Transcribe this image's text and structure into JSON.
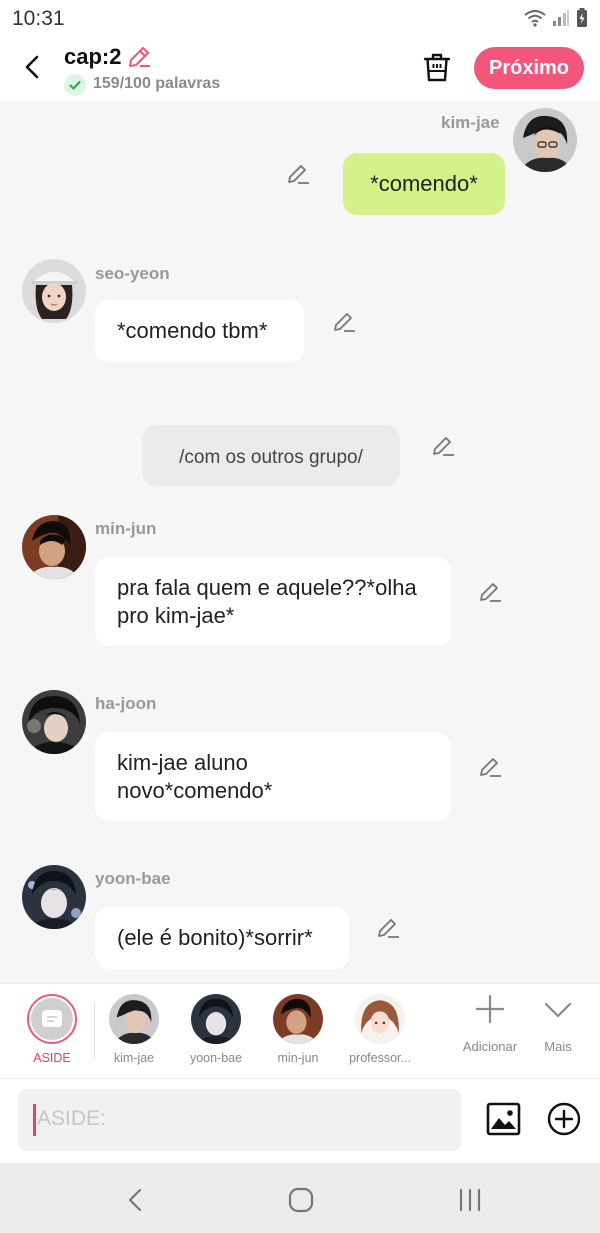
{
  "status": {
    "time": "10:31"
  },
  "header": {
    "title": "cap:2",
    "word_count": "159/100 palavras",
    "next_label": "Próximo"
  },
  "messages": [
    {
      "sender": "kim-jae",
      "text": "*comendo*",
      "side": "right",
      "color": "#d4f18a"
    },
    {
      "sender": "seo-yeon",
      "text": "*comendo tbm*",
      "side": "left"
    },
    {
      "sender": "",
      "text": "/com os outros grupo/",
      "side": "center",
      "type": "aside"
    },
    {
      "sender": "min-jun",
      "text": "pra fala quem e aquele??*olha pro kim-jae*",
      "side": "left"
    },
    {
      "sender": "ha-joon",
      "text": "kim-jae aluno novo*comendo*",
      "side": "left"
    },
    {
      "sender": "yoon-bae",
      "text": "(ele é bonito)*sorrir*",
      "side": "left"
    }
  ],
  "characters": [
    {
      "label": "ASIDE",
      "active": true
    },
    {
      "label": "kim-jae"
    },
    {
      "label": "yoon-bae"
    },
    {
      "label": "min-jun"
    },
    {
      "label": "professor..."
    }
  ],
  "tools": {
    "add_label": "Adicionar",
    "more_label": "Mais"
  },
  "input": {
    "placeholder": "ASIDE:"
  },
  "colors": {
    "accent": "#f2567a",
    "my_bubble": "#d4f18a"
  }
}
